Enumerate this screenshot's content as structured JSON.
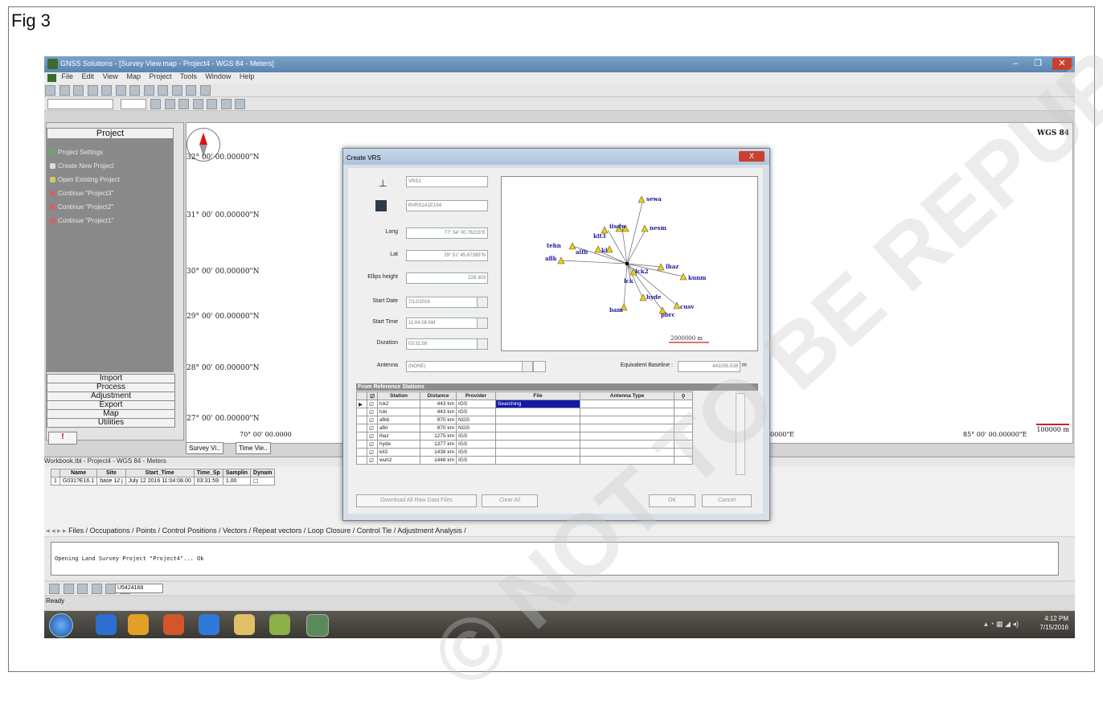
{
  "figure_label": "Fig 3",
  "watermark": "© NOT TO BE REPUBLISHED",
  "window": {
    "title": "GNSS Solutions - [Survey View.map - Project4 - WGS 84 - Meters]",
    "menu": [
      "File",
      "Edit",
      "View",
      "Map",
      "Project",
      "Tools",
      "Window",
      "Help"
    ]
  },
  "left_panel": {
    "header": "Project",
    "items": [
      "Project Settings",
      "Create New Project",
      "Open Existing Project",
      "Continue \"Project3\"",
      "Continue \"Project2\"",
      "Continue \"Project1\""
    ],
    "categories": [
      "Import",
      "Process",
      "Adjustment",
      "Export",
      "Map",
      "Utilities"
    ],
    "alert": "!"
  },
  "map": {
    "datum": "WGS 84",
    "latitudes": [
      "32° 00' 00.00000\"N",
      "31° 00' 00.00000\"N",
      "30° 00' 00.00000\"N",
      "29° 00' 00.00000\"N",
      "28° 00' 00.00000\"N",
      "27° 00' 00.00000\"N"
    ],
    "lon_left": "70° 00' 00.0000",
    "lon_mid": "0000\"E",
    "lon_right": "85° 00' 00.00000\"E",
    "scale": "100000 m"
  },
  "view_tabs": [
    "Survey Vi..",
    "Time Vie.."
  ],
  "dialog": {
    "title": "Create VRS",
    "close": "X",
    "name": "VRS1",
    "file": "BVRS1A1E194",
    "long_label": "Long",
    "long": "77° 54' 00.76223\"E",
    "lat_label": "Lat",
    "lat": "29° 51' 45.67395\"N",
    "ellips_label": "Ellips height",
    "ellips": "228.303",
    "start_date_label": "Start Date",
    "start_date": "7/12/2016",
    "start_time_label": "Start Time",
    "start_time": "11:04:08 AM",
    "duration_label": "Duration",
    "duration": "03:31:59",
    "antenna_label": "Antenna",
    "antenna": "(NONE)",
    "baseline_label": "Equivalent Baseline :",
    "baseline": "443255.538",
    "baseline_unit": "m",
    "preview_scale": "2000000 m",
    "stations": [
      "sewa",
      "nesm",
      "tehn",
      "kit3",
      "iisc",
      "alfb",
      "aflk",
      "kl",
      "lck2",
      "lhaz",
      "kunm",
      "hyde",
      "bam",
      "pbrc",
      "cusv",
      "lw",
      "lck"
    ],
    "ref_header": "From Reference Stations",
    "columns": [
      "",
      "Station",
      "Distance",
      "Provider",
      "File",
      "Antenna Type"
    ],
    "rows": [
      {
        "station": "lck2",
        "distance": "443 km",
        "provider": "IGS",
        "file": "Searching"
      },
      {
        "station": "lcki",
        "distance": "443 km",
        "provider": "IGS",
        "file": ""
      },
      {
        "station": "afkb",
        "distance": "970 km",
        "provider": "NGS",
        "file": ""
      },
      {
        "station": "afkl",
        "distance": "970 km",
        "provider": "NGS",
        "file": ""
      },
      {
        "station": "lhaz",
        "distance": "1275 km",
        "provider": "IGS",
        "file": ""
      },
      {
        "station": "hyde",
        "distance": "1377 km",
        "provider": "IGS",
        "file": ""
      },
      {
        "station": "kit3",
        "distance": "1438 km",
        "provider": "IGS",
        "file": ""
      },
      {
        "station": "wuh2",
        "distance": "1448 km",
        "provider": "IGS",
        "file": ""
      }
    ],
    "btn_download": "Download All Raw Data Files",
    "btn_clear": "Clear All",
    "btn_ok": "OK",
    "btn_cancel": "Cancel"
  },
  "workbook": {
    "title": "Workbook.tbl - Project4 - WGS 84 - Meters",
    "columns": [
      "Name",
      "Site",
      "Start_Time",
      "Time_Sp",
      "Samplin",
      "Dynam"
    ],
    "row_index": "1",
    "row": [
      "G031?E16.1",
      "base 12 j",
      "July 12 2016 11:04:08.00",
      "03:31:59",
      "1.00",
      ""
    ],
    "tabs": "Files / Occupations / Points / Control Positions / Vectors / Repeat vectors / Loop Closure / Control Tie / Adjustment Analysis /"
  },
  "console_message": "Opening Land Survey Project \"Project4\"... Ok",
  "zoom_value": "U5424168",
  "status_text": "Ready",
  "clock_time": "4:12 PM",
  "clock_date": "7/15/2016"
}
